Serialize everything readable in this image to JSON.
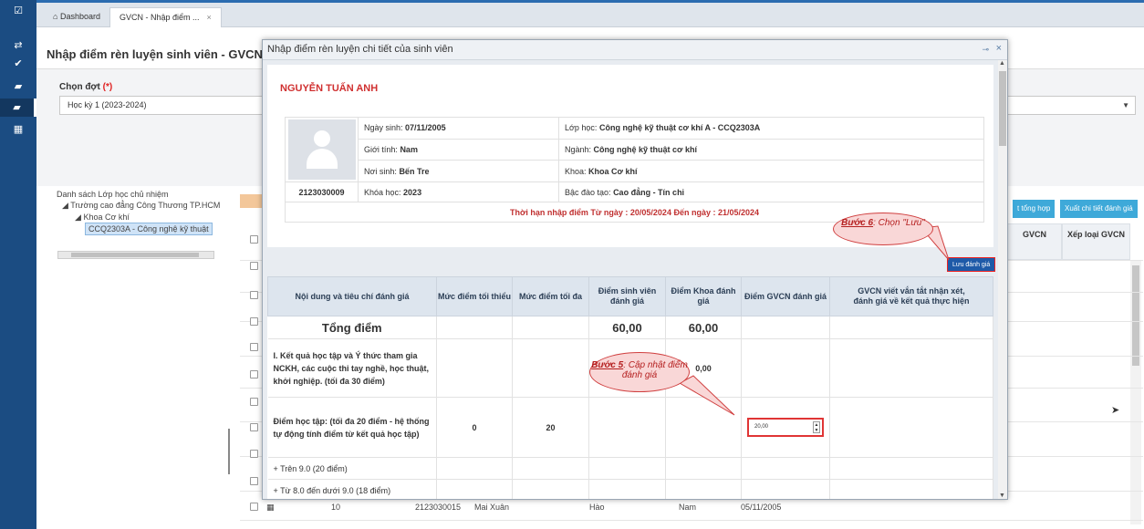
{
  "tabs": {
    "dashboard": "Dashboard",
    "active": "GVCN - Nhập điểm ...",
    "close_glyph": "×"
  },
  "main": {
    "title": "Nhập điểm rèn luyện sinh viên - GVCN",
    "filter": {
      "label": "Chọn đợt",
      "required": "(*)",
      "selected": "Học kỳ 1 (2023-2024)"
    },
    "tree": {
      "title": "Danh sách Lớp học chủ nhiệm",
      "nodes": [
        "Trường cao đẳng Công Thương TP.HCM",
        "Khoa Cơ khí",
        "CCQ2303A - Công nghệ kỹ thuật"
      ]
    },
    "grid": {
      "buttons": [
        "t tổng hợp",
        "Xuất chi tiết đánh giá"
      ],
      "headers": [
        "GVCN",
        "Xếp loại GVCN"
      ],
      "bottom_row": [
        "10",
        "2123030015",
        "Mai Xuân",
        "Hào",
        "Nam",
        "05/11/2005"
      ]
    }
  },
  "modal": {
    "title": "Nhập điểm rèn luyện chi tiết của sinh viên",
    "pin_glyph": "⊸",
    "close_glyph": "×",
    "student_name": "NGUYỄN TUẤN ANH",
    "student_id": "2123030009",
    "info": {
      "dob_label": "Ngày sinh:",
      "dob": "07/11/2005",
      "gender_label": "Giới tính:",
      "gender": "Nam",
      "birthplace_label": "Nơi sinh:",
      "birthplace": "Bến Tre",
      "course_label": "Khóa học:",
      "course": "2023",
      "class_label": "Lớp học:",
      "class": "Công nghệ kỹ thuật cơ khí A - CCQ2303A",
      "major_label": "Ngành:",
      "major": "Công nghệ kỹ thuật cơ khí",
      "faculty_label": "Khoa:",
      "faculty": "Khoa Cơ khí",
      "level_label": "Bậc đào tạo:",
      "level": "Cao đẳng - Tín chỉ"
    },
    "deadline": "Thời hạn nhập điểm Từ ngày : 20/05/2024 Đến ngày : 21/05/2024",
    "save_label": "Lưu đánh giá",
    "table": {
      "headers": [
        "Nội dung và tiêu chí đánh giá",
        "Mức điểm tối thiểu",
        "Mức điểm tối đa",
        "Điểm sinh viên đánh giá",
        "Điểm Khoa đánh giá",
        "Điểm GVCN đánh giá",
        "GVCN viết vắn tắt nhận xét, đánh giá về kết quả thực hiện"
      ],
      "total_label": "Tổng điểm",
      "total_student": "60,00",
      "total_faculty": "60,00",
      "row1_label": "I. Kết quả học tập và Ý thức tham gia NCKH, các cuộc thi tay nghề, học thuật, khởi nghiệp. (tối đa 30 điểm)",
      "row1_faculty_partial": "0,00",
      "row2_label": "Điểm học tập: (tối đa 20 điểm - hệ thống tự động tính điểm từ kết quả học tập)",
      "row2_min": "0",
      "row2_max": "20",
      "row2_gvcn_value": "20,00",
      "row3_label": "+ Trên 9.0 (20 điểm)",
      "row4_label": "+ Từ 8.0 đến dưới 9.0 (18 điểm)"
    }
  },
  "callouts": {
    "step6_step": "Bước 6",
    "step6_text": ": Chọn \"Lưu\"",
    "step5_step": "Bước 5",
    "step5_text": ": Cập nhật điểm đánh giá"
  },
  "colors": {
    "sidebar": "#1b4c82",
    "accent_red": "#d03030",
    "save_button": "#1e5aa8",
    "table_header": "#dde5ee"
  }
}
